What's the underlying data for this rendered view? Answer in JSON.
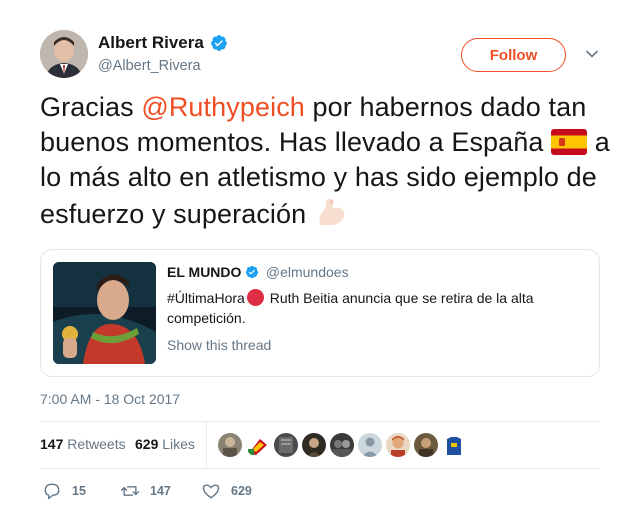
{
  "author": {
    "name": "Albert Rivera",
    "handle": "@Albert_Rivera",
    "verified": true
  },
  "follow_label": "Follow",
  "tweet": {
    "text_before": "Gracias ",
    "mention": "@Ruthypeich",
    "text_middle": " por habernos dado tan buenos momentos. Has llevado a España ",
    "text_after": " a lo más alto en atletismo y has sido ejemplo de esfuerzo y superación ",
    "emoji_1": "spain-flag-icon",
    "emoji_2": "flexed-biceps-icon"
  },
  "quoted_tweet": {
    "name": "EL MUNDO",
    "handle": "@elmundoes",
    "verified": true,
    "hashtag": "#ÚltimaHora",
    "text": " Ruth Beitia anuncia que se retira de la alta competición.",
    "show_thread": "Show this thread"
  },
  "timestamp": "7:00 AM - 18 Oct 2017",
  "stats": {
    "retweets_count": "147",
    "retweets_label": "Retweets",
    "likes_count": "629",
    "likes_label": "Likes"
  },
  "actions": {
    "replies": "15",
    "retweets": "147",
    "likes": "629"
  },
  "colors": {
    "accent": "#f04e24",
    "verified": "#1da1f2",
    "muted": "#657786",
    "text": "#14171a"
  }
}
